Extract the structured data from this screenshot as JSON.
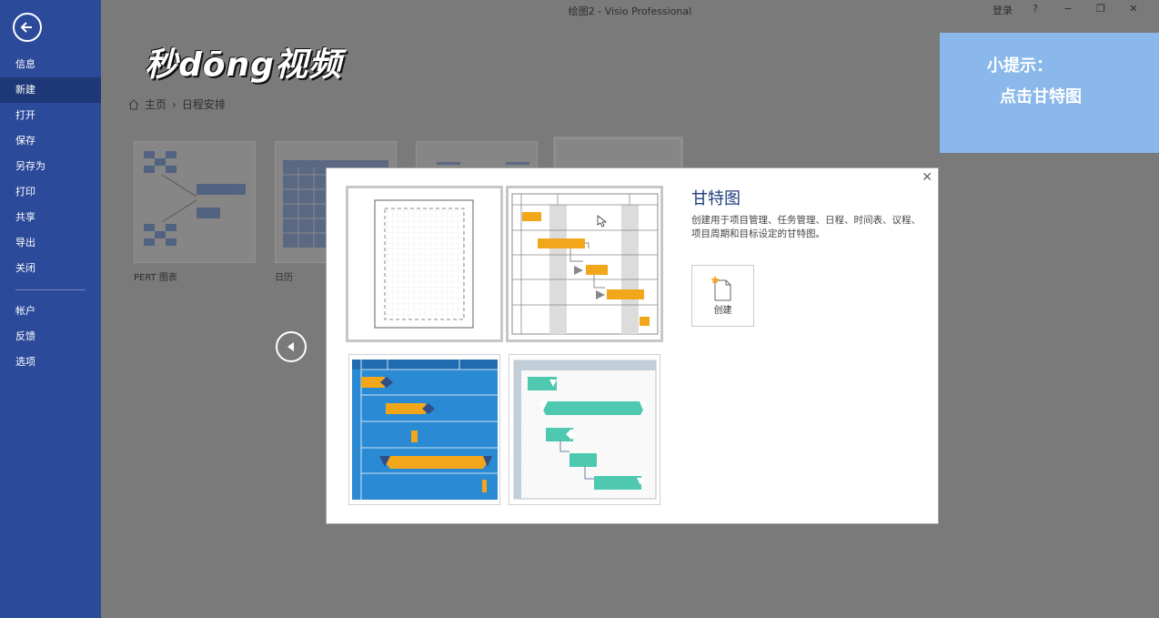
{
  "window": {
    "title": "绘图2  -  Visio Professional",
    "signin": "登录",
    "help": "?",
    "minimize": "−",
    "restore": "❐",
    "close": "✕"
  },
  "sidebar": {
    "items": [
      {
        "label": "信息"
      },
      {
        "label": "新建"
      },
      {
        "label": "打开"
      },
      {
        "label": "保存"
      },
      {
        "label": "另存为"
      },
      {
        "label": "打印"
      },
      {
        "label": "共享"
      },
      {
        "label": "导出"
      },
      {
        "label": "关闭"
      },
      {
        "label": "帐户"
      },
      {
        "label": "反馈"
      },
      {
        "label": "选项"
      }
    ]
  },
  "watermark": "秒dōng视频",
  "breadcrumb": {
    "home": "主页",
    "separator": "›",
    "current": "日程安排"
  },
  "thumbnails": [
    {
      "label": "PERT 图表"
    },
    {
      "label": "日历"
    }
  ],
  "hint": {
    "line1": "小提示：",
    "line2": "点击甘特图"
  },
  "dialog": {
    "close": "✕",
    "title": "甘特图",
    "description": "创建用于项目管理、任务管理、日程、时间表、议程、项目周期和目标设定的甘特图。",
    "create_label": "创建"
  },
  "colors": {
    "sidebar": "#2b4a9a",
    "accent_orange": "#f2a71b",
    "teal": "#4fc8b0",
    "blue_theme": "#2a8ad4",
    "hint_bg": "#8ab8ea"
  }
}
